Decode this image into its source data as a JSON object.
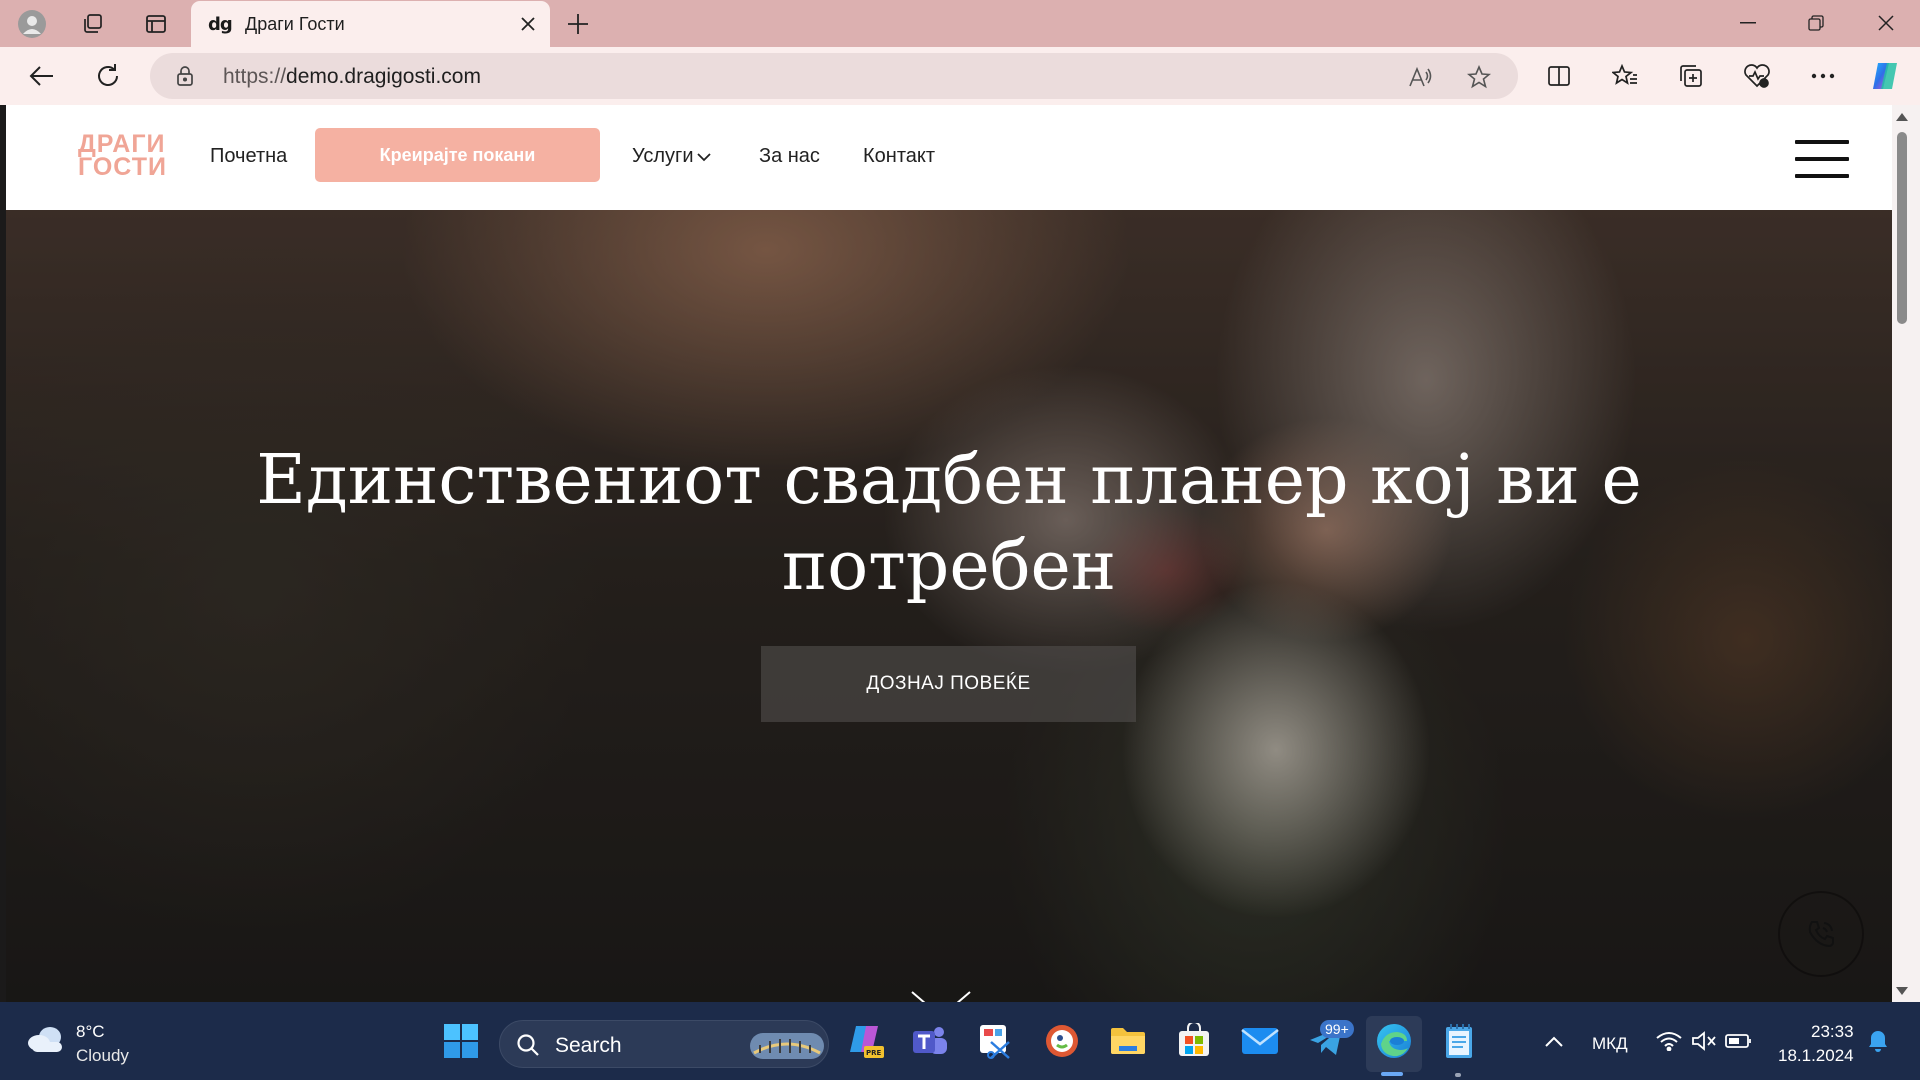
{
  "browser": {
    "tab_title": "Драги Гости",
    "tab_favicon": "dg",
    "url_scheme": "https://",
    "url_host": "demo.dragigosti.com"
  },
  "site": {
    "logo_line1": "ДРАГИ",
    "logo_line2": "ГОСТИ",
    "nav": {
      "home": "Почетна",
      "create": "Креирајте покани",
      "services": "Услуги",
      "about": "За нас",
      "contact": "Контакт"
    },
    "hero": {
      "title": "Единствениот свадбен планер кој ви е потребен",
      "button": "ДОЗНАЈ ПОВЕЌЕ"
    },
    "colors": {
      "accent": "#f5b1a2",
      "logo": "#f0a596"
    }
  },
  "taskbar": {
    "weather_temp": "8°C",
    "weather_desc": "Cloudy",
    "search_placeholder": "Search",
    "badge": "99+",
    "language": "МКД",
    "time": "23:33",
    "date": "18.1.2024"
  }
}
